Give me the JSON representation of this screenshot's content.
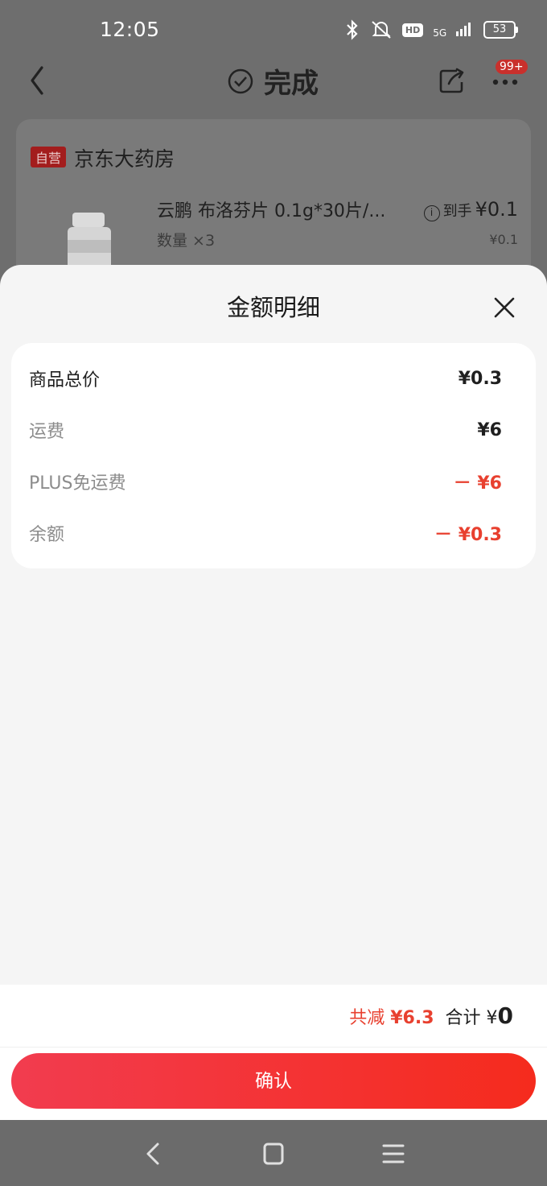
{
  "status_bar": {
    "time": "12:05",
    "hd": "HD",
    "network": "5G",
    "battery": "53"
  },
  "nav": {
    "title": "完成",
    "badge": "99+"
  },
  "order": {
    "shop_tag": "自营",
    "shop_name": "京东大药房",
    "product_name": "云鹏 布洛芬片 0.1g*30片/...",
    "quantity": "数量 ×3",
    "price_prefix": "到手",
    "price": "¥0.1",
    "original_price": "¥0.1"
  },
  "sheet": {
    "title": "金额明细",
    "rows": [
      {
        "label": "商品总价",
        "value": "¥0.3"
      },
      {
        "label": "运费",
        "value": "¥6"
      },
      {
        "label": "PLUS免运费",
        "value": "－ ¥6"
      },
      {
        "label": "余额",
        "value": "－ ¥0.3"
      }
    ]
  },
  "summary": {
    "reduce_label": "共减",
    "reduce_value": "¥6.3",
    "total_label": "合计",
    "total_currency": "¥",
    "total_value": "0"
  },
  "confirm_label": "确认",
  "colors": {
    "accent_red": "#e8402f",
    "button_start": "#f23c4f",
    "button_end": "#f52b1d"
  }
}
